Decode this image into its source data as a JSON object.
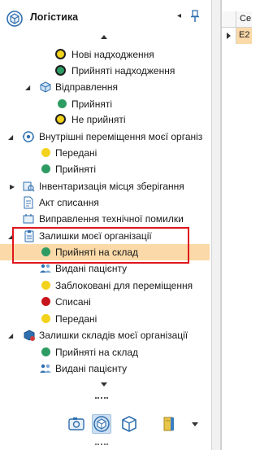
{
  "panel": {
    "title": "Логістика",
    "icon": "logistics-cube-icon",
    "collapse_glyph": "◂",
    "pin_icon": "pin-icon"
  },
  "tree": {
    "items": [
      {
        "label": "Нові надходження",
        "icon": "status-dot-yellow-ringed"
      },
      {
        "label": "Прийняті надходження",
        "icon": "status-dot-green-ringed"
      },
      {
        "label": "Відправлення",
        "icon": "shipment-box-icon"
      },
      {
        "label": "Прийняті",
        "icon": "status-dot-green"
      },
      {
        "label": "Не прийняті",
        "icon": "status-dot-yellow-ringed"
      },
      {
        "label": "Внутрішні переміщення моєї організ",
        "icon": "internal-transfer-icon"
      },
      {
        "label": "Передані",
        "icon": "status-dot-yellow"
      },
      {
        "label": "Прийняті",
        "icon": "status-dot-green"
      },
      {
        "label": "Інвентаризація місця зберігання",
        "icon": "inventory-icon"
      },
      {
        "label": "Акт списання",
        "icon": "document-icon"
      },
      {
        "label": "Виправлення технічної помилки",
        "icon": "fix-error-icon"
      },
      {
        "label": "Залишки моєї організації",
        "icon": "balances-clipboard-icon"
      },
      {
        "label": "Прийняті на склад",
        "icon": "status-dot-green"
      },
      {
        "label": "Видані пацієнту",
        "icon": "patients-icon"
      },
      {
        "label": "Заблоковані для переміщення",
        "icon": "status-dot-yellow"
      },
      {
        "label": "Списані",
        "icon": "status-dot-red"
      },
      {
        "label": "Передані",
        "icon": "status-dot-yellow"
      },
      {
        "label": "Залишки складів моєї організації",
        "icon": "warehouse-balances-icon"
      },
      {
        "label": "Прийняті на склад",
        "icon": "status-dot-green"
      },
      {
        "label": "Видані пацієнту",
        "icon": "patients-icon"
      }
    ],
    "selected_label": "Прийняті на склад"
  },
  "toolbar": {
    "buttons": [
      "camera-icon",
      "logistics-cube-icon",
      "box-outline-icon",
      "book-icon"
    ],
    "active": "logistics-cube-icon"
  },
  "grid": {
    "column_header": "Се",
    "row_value": "E2"
  },
  "colors": {
    "selected_row": "#fbd9a8",
    "highlight_box": "#e0161c",
    "dot_green": "#2e9b63",
    "dot_yellow": "#f2d21b",
    "dot_red": "#c8141b"
  }
}
